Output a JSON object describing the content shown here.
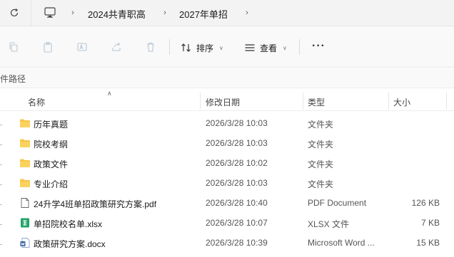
{
  "address": {
    "breadcrumbs": [
      "2024共青职高",
      "2027年单招"
    ]
  },
  "toolbar": {
    "sort_label": "排序",
    "view_label": "查看",
    "more_label": "···"
  },
  "path_row": {
    "label": "件路径"
  },
  "columns": {
    "name": "名称",
    "modified": "修改日期",
    "type": "类型",
    "size": "大小"
  },
  "files": [
    {
      "name": "历年真题",
      "modified": "2026/3/28 10:03",
      "type": "文件夹",
      "size": "",
      "icon": "folder-icon"
    },
    {
      "name": "院校考纲",
      "modified": "2026/3/28 10:03",
      "type": "文件夹",
      "size": "",
      "icon": "folder-icon"
    },
    {
      "name": "政策文件",
      "modified": "2026/3/28 10:02",
      "type": "文件夹",
      "size": "",
      "icon": "folder-icon"
    },
    {
      "name": "专业介绍",
      "modified": "2026/3/28 10:03",
      "type": "文件夹",
      "size": "",
      "icon": "folder-icon"
    },
    {
      "name": "24升学4班单招政策研究方案.pdf",
      "modified": "2026/3/28 10:40",
      "type": "PDF Document",
      "size": "126 KB",
      "icon": "pdf-file-icon"
    },
    {
      "name": "单招院校名单.xlsx",
      "modified": "2026/3/28 10:07",
      "type": "XLSX 文件",
      "size": "7 KB",
      "icon": "excel-file-icon"
    },
    {
      "name": "政策研究方案.docx",
      "modified": "2026/3/28 10:39",
      "type": "Microsoft Word ...",
      "size": "15 KB",
      "icon": "word-file-icon"
    }
  ],
  "colors": {
    "folder": "#f7c548",
    "excel": "#21a366",
    "word": "#2b579a"
  }
}
